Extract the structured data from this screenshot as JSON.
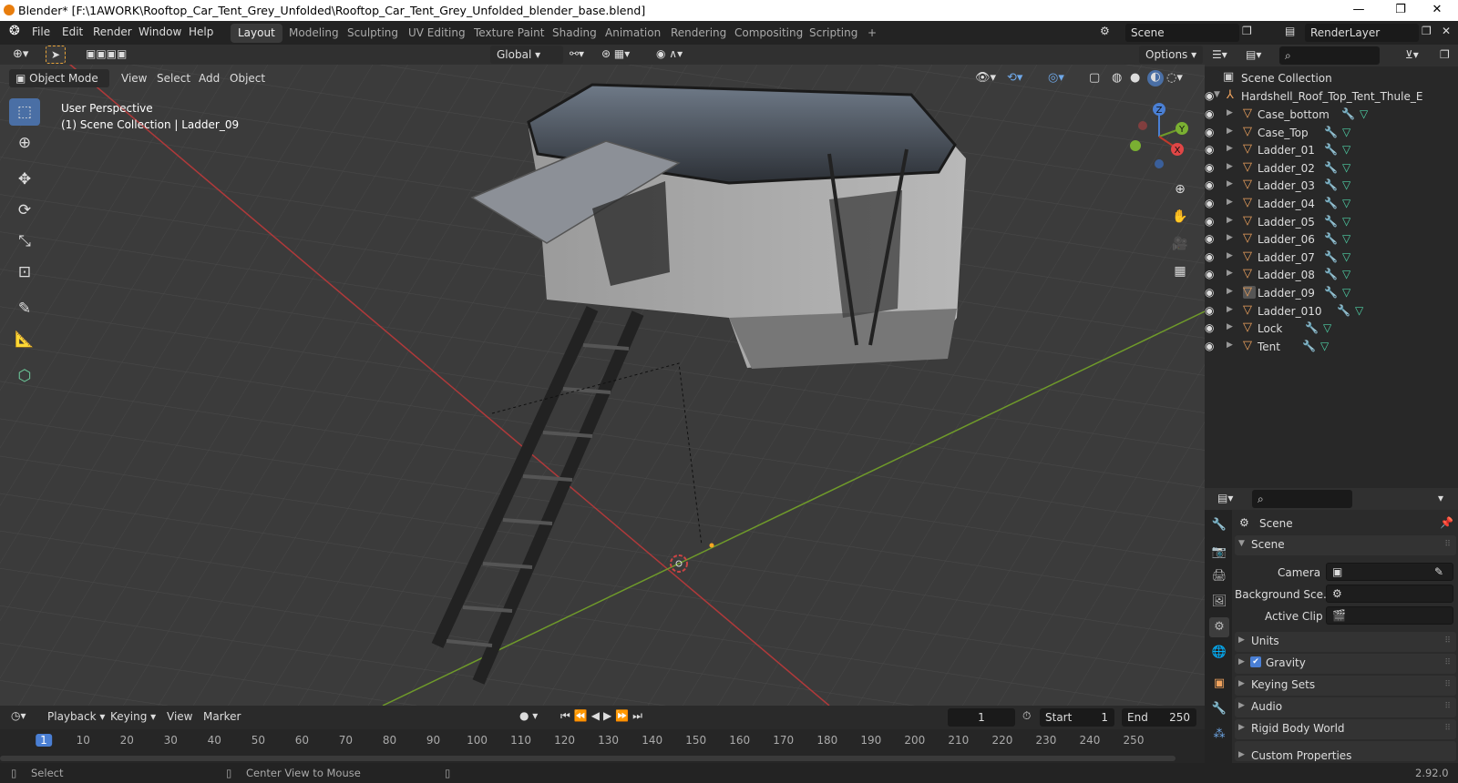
{
  "title_bar": {
    "text": "Blender* [F:\\1AWORK\\Rooftop_Car_Tent_Grey_Unfolded\\Rooftop_Car_Tent_Grey_Unfolded_blender_base.blend]",
    "minimize": "—",
    "restore": "❐",
    "close": "✕"
  },
  "menu": [
    "File",
    "Edit",
    "Render",
    "Window",
    "Help"
  ],
  "workspaces": [
    "Layout",
    "Modeling",
    "Sculpting",
    "UV Editing",
    "Texture Paint",
    "Shading",
    "Animation",
    "Rendering",
    "Compositing",
    "Scripting",
    "+"
  ],
  "active_workspace": "Layout",
  "scene_field": "Scene",
  "render_layer_field": "RenderLayer",
  "viewport_header": {
    "transform_orientation": "Global",
    "options": "Options",
    "mode": "Object Mode",
    "menus": [
      "View",
      "Select",
      "Add",
      "Object"
    ]
  },
  "viewport_overlay": {
    "perspective": "User Perspective",
    "collection": "(1) Scene Collection | Ladder_09"
  },
  "gizmo_axes": {
    "x": "X",
    "y": "Y",
    "z": "Z"
  },
  "outliner": {
    "scene_collection": "Scene Collection",
    "root": "Hardshell_Roof_Top_Tent_Thule_E",
    "items": [
      "Case_bottom",
      "Case_Top",
      "Ladder_01",
      "Ladder_02",
      "Ladder_03",
      "Ladder_04",
      "Ladder_05",
      "Ladder_06",
      "Ladder_07",
      "Ladder_08",
      "Ladder_09",
      "Ladder_010",
      "Lock",
      "Tent"
    ],
    "selected": "Ladder_09"
  },
  "properties": {
    "header": "Scene",
    "panel_title": "Scene",
    "camera_label": "Camera",
    "background_label": "Background Sce...",
    "active_clip_label": "Active Clip",
    "subpanels": [
      "Units",
      "Gravity",
      "Keying Sets",
      "Audio",
      "Rigid Body World",
      "Custom Properties"
    ],
    "gravity_checked": true
  },
  "timeline": {
    "menus": [
      "Playback",
      "Keying",
      "View",
      "Marker"
    ],
    "current_frame": "1",
    "start_label": "Start",
    "start_value": "1",
    "end_label": "End",
    "end_value": "250",
    "ticks": [
      "1",
      "10",
      "20",
      "30",
      "40",
      "50",
      "60",
      "70",
      "80",
      "90",
      "100",
      "110",
      "120",
      "130",
      "140",
      "150",
      "160",
      "170",
      "180",
      "190",
      "200",
      "210",
      "220",
      "230",
      "240",
      "250"
    ]
  },
  "status_bar": {
    "select": "Select",
    "center_view": "Center View to Mouse",
    "version": "2.92.0"
  },
  "colors": {
    "accent": "#4a6fa5",
    "object_orange": "#f0a35e",
    "x_axis": "#c0392b",
    "y_axis": "#7ab032"
  }
}
